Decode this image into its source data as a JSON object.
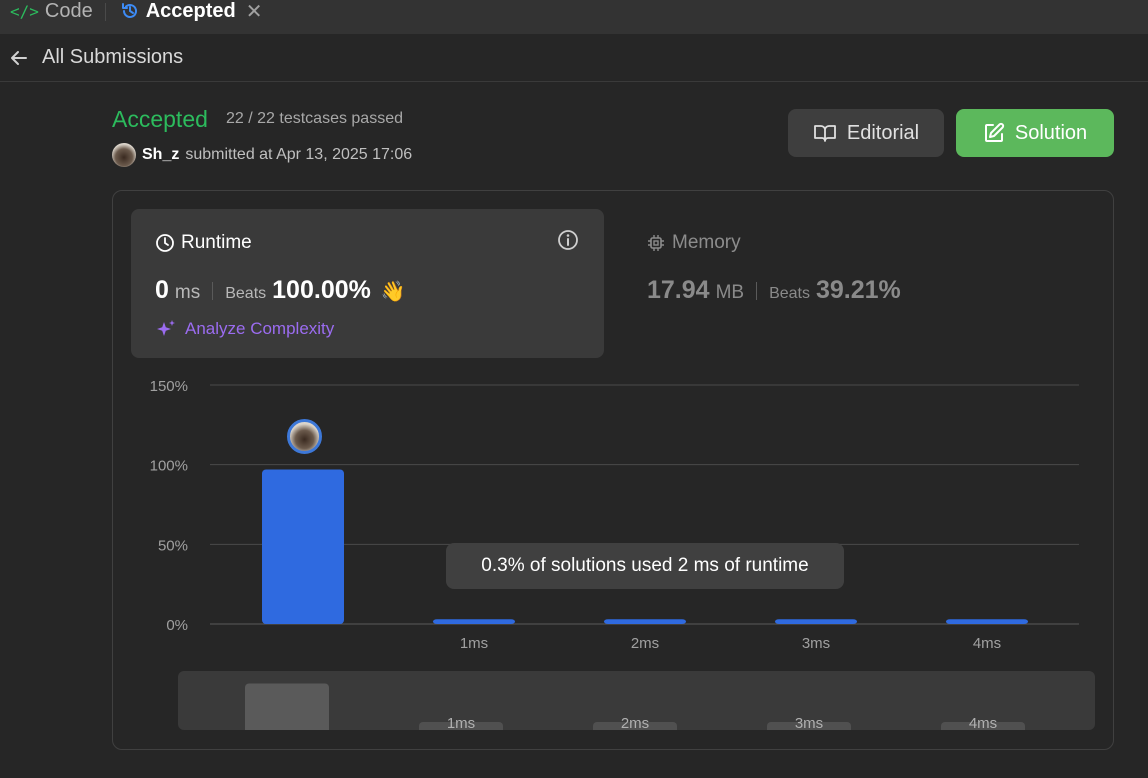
{
  "tabs": {
    "code_label": "Code",
    "code_icon": "code-brackets-icon",
    "accepted_label": "Accepted",
    "accepted_icon": "history-icon",
    "close_icon": "close-icon"
  },
  "nav": {
    "back_label": "All Submissions"
  },
  "result": {
    "status": "Accepted",
    "testcases": "22 / 22 testcases passed",
    "username": "Sh_z",
    "submitted_text": "submitted at Apr 13, 2025 17:06"
  },
  "buttons": {
    "editorial": "Editorial",
    "solution": "Solution"
  },
  "runtime": {
    "title": "Runtime",
    "value": "0",
    "unit": "ms",
    "beats_label": "Beats",
    "beats_value": "100.00%",
    "analyze_label": "Analyze Complexity"
  },
  "memory": {
    "title": "Memory",
    "value": "17.94",
    "unit": "MB",
    "beats_label": "Beats",
    "beats_value": "39.21%"
  },
  "tooltip": "0.3% of solutions used 2 ms of runtime",
  "colors": {
    "accent_green": "#2cbb5d",
    "bar_blue": "#2f6ae0",
    "solution_button": "#5cb85c",
    "analyze_purple": "#9b6cf0"
  },
  "chart_data": {
    "type": "bar",
    "categories": [
      "",
      "1ms",
      "2ms",
      "3ms",
      "4ms"
    ],
    "values": [
      97,
      3,
      3,
      3,
      3
    ],
    "ylim": [
      0,
      150
    ],
    "yticks": [
      "0%",
      "50%",
      "100%",
      "150%"
    ],
    "ytick_values": [
      0,
      50,
      100,
      150
    ],
    "grid": true,
    "mini_labels": [
      "1ms",
      "2ms",
      "3ms",
      "4ms"
    ]
  }
}
